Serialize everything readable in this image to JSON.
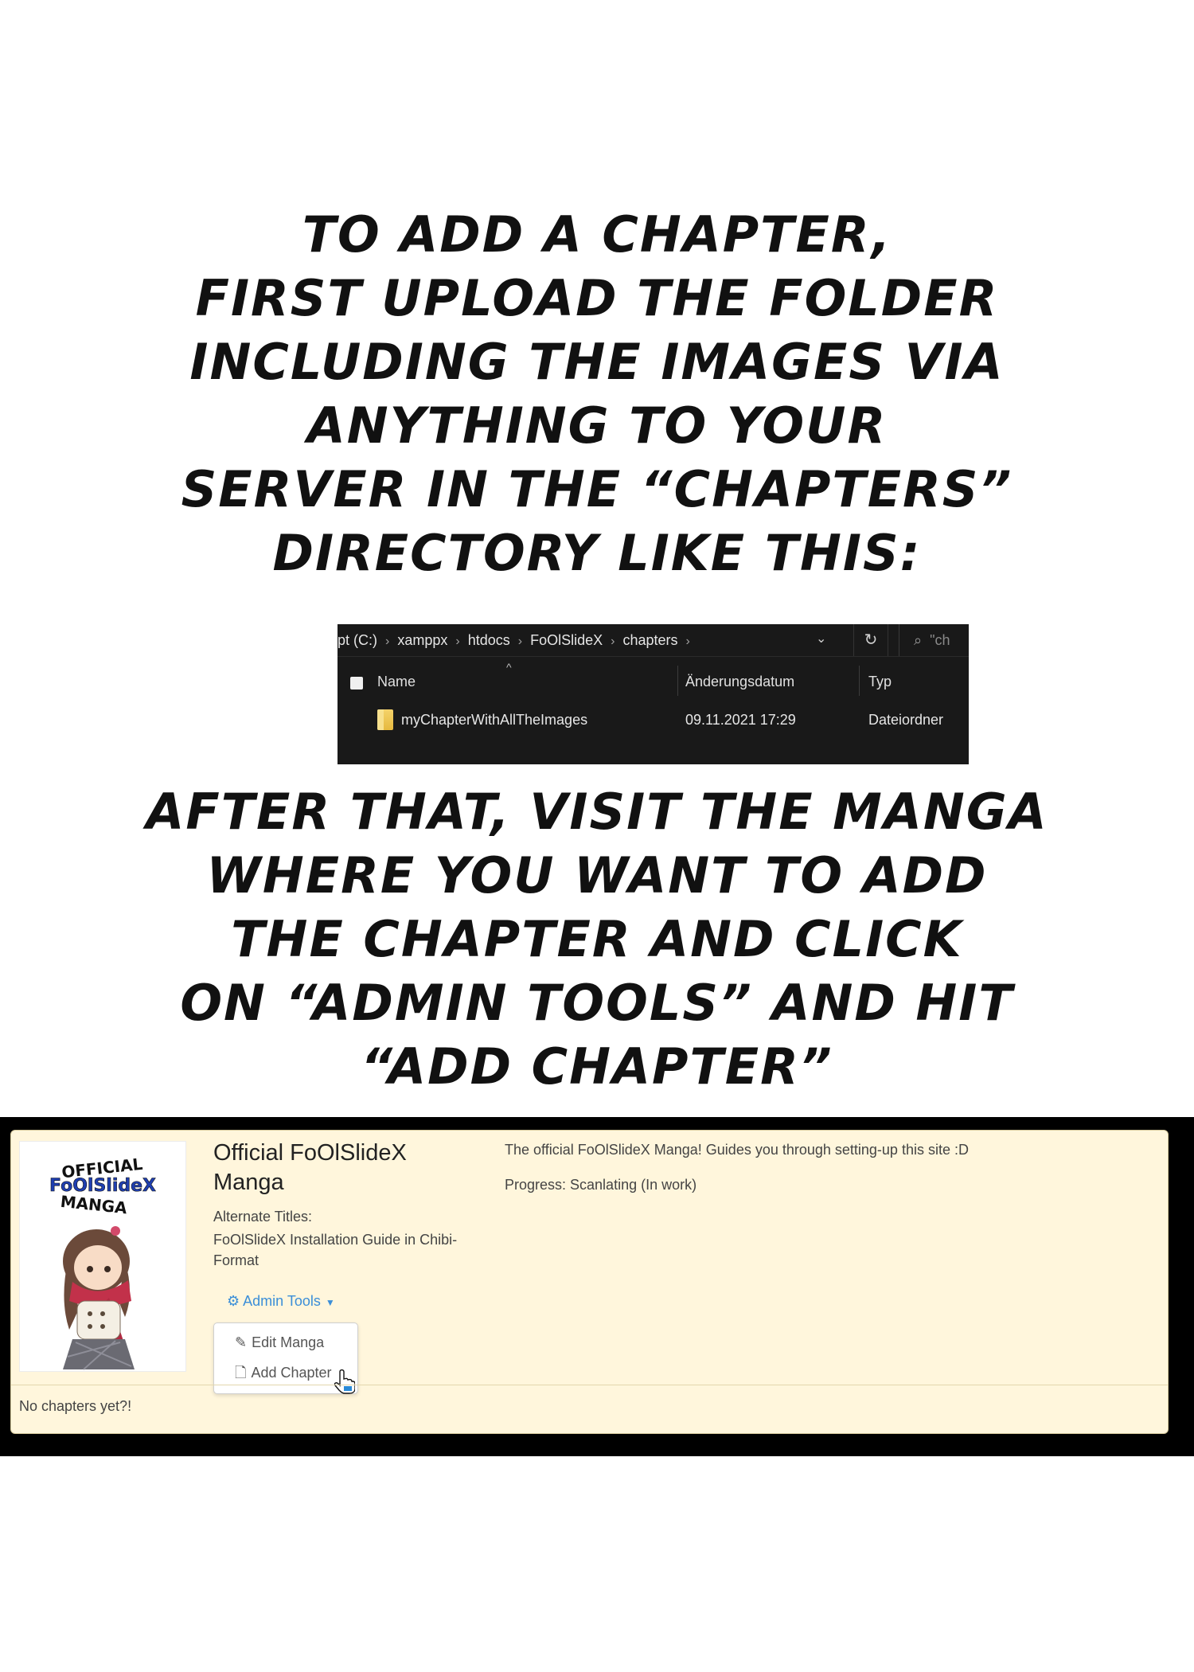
{
  "caption_top": {
    "lines": [
      "To add a chapter,",
      "first upload the folder",
      "including the images via",
      "anything to your",
      "server in the “chapters”",
      "directory like this:"
    ]
  },
  "explorer": {
    "breadcrumbs": [
      "pt (C:)",
      "xamppx",
      "htdocs",
      "FoOlSlideX",
      "chapters"
    ],
    "breadcrumb_separator": "›",
    "search_placeholder": "\"ch",
    "columns": [
      "Name",
      "Änderungsdatum",
      "Typ"
    ],
    "row": {
      "name": "myChapterWithAllTheImages",
      "date": "09.11.2021 17:29",
      "type": "Dateiordner"
    },
    "icons": [
      "chevron-down-icon",
      "refresh-icon",
      "search-icon",
      "folder-icon",
      "sort-up-icon"
    ]
  },
  "caption_bottom": {
    "lines": [
      "After that, visit the manga",
      "where you want to add",
      "the chapter and click",
      "on “Admin Tools” and hit",
      "“Add Chapter”"
    ]
  },
  "manga": {
    "cover_text": [
      "OFFICIAL",
      "FoOlSlideX",
      "MANGA"
    ],
    "title": "Official FoOlSlideX Manga",
    "alt_titles_label": "Alternate Titles:",
    "alt_titles_value": "FoOlSlideX Installation Guide in Chibi-Format",
    "admin_tools_label": "Admin Tools",
    "menu": {
      "edit": "Edit Manga",
      "add": "Add Chapter"
    },
    "description": "The official FoOlSlideX Manga! Guides you through setting-up this site :D",
    "progress": "Progress: Scanlating (In work)",
    "no_chapters": "No chapters yet?!",
    "colors": {
      "card_bg": "#fff6dc",
      "link": "#3b8ed8",
      "frame": "#000000"
    }
  }
}
